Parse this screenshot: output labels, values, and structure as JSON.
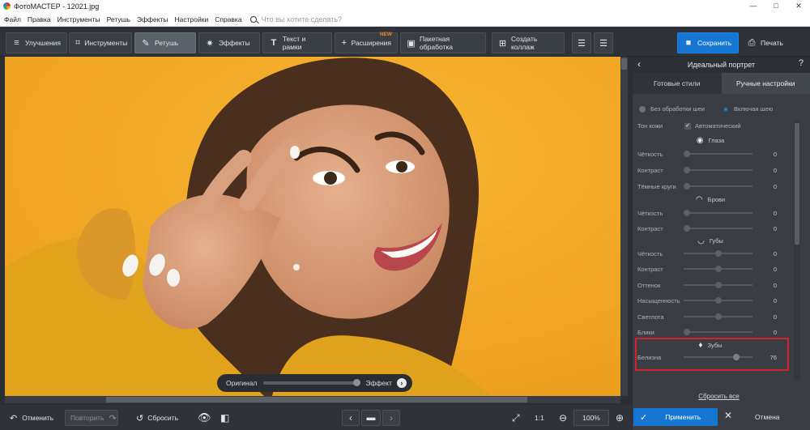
{
  "window": {
    "title": "ФотоМАСТЕР - 12021.jpg",
    "min": "—",
    "max": "□",
    "close": "✕"
  },
  "menu": {
    "items": [
      "Файл",
      "Правка",
      "Инструменты",
      "Ретушь",
      "Эффекты",
      "Настройки",
      "Справка"
    ],
    "search_placeholder": "Что вы хотите сделать?"
  },
  "toolbar": {
    "improve": "Улучшения",
    "tools": "Инструменты",
    "retouch": "Ретушь",
    "effects": "Эффекты",
    "text": "Текст и рамки",
    "ext": "Расширения",
    "ext_badge": "NEW",
    "batch": "Пакетная обработка",
    "collage": "Создать коллаж",
    "save": "Сохранить",
    "print": "Печать"
  },
  "compare": {
    "original": "Оригинал",
    "effect": "Эффект",
    "position": 0.97
  },
  "bottom": {
    "undo": "Отменить",
    "redo": "Повторить",
    "reset": "Сбросить",
    "one_to_one": "1:1",
    "zoom": "100%"
  },
  "panel": {
    "title": "Идеальный портрет",
    "tab_styles": "Готовые стили",
    "tab_manual": "Ручные настройки",
    "radio_off": "Без обработки шеи",
    "radio_on": "Включая шею",
    "skin_label": "Тон кожи",
    "skin_auto": "Автоматический",
    "eyes": {
      "title": "Глаза",
      "rows": [
        {
          "label": "Чёткость",
          "value": "0",
          "pos": 0.05
        },
        {
          "label": "Контраст",
          "value": "0",
          "pos": 0.05
        },
        {
          "label": "Тёмные круги",
          "value": "0",
          "pos": 0.05
        }
      ]
    },
    "brows": {
      "title": "Брови",
      "rows": [
        {
          "label": "Чёткость",
          "value": "0",
          "pos": 0.05
        },
        {
          "label": "Контраст",
          "value": "0",
          "pos": 0.05
        }
      ]
    },
    "lips": {
      "title": "Губы",
      "rows": [
        {
          "label": "Чёткость",
          "value": "0",
          "pos": 0.5
        },
        {
          "label": "Контраст",
          "value": "0",
          "pos": 0.5
        },
        {
          "label": "Оттенок",
          "value": "0",
          "pos": 0.5
        },
        {
          "label": "Насыщенность",
          "value": "0",
          "pos": 0.5
        },
        {
          "label": "Светлота",
          "value": "0",
          "pos": 0.5
        },
        {
          "label": "Блики",
          "value": "0",
          "pos": 0.05
        }
      ]
    },
    "teeth": {
      "title": "Зубы",
      "rows": [
        {
          "label": "Белизна",
          "value": "76",
          "pos": 0.76
        }
      ]
    },
    "reset_all": "Сбросить все",
    "apply": "Применить",
    "cancel": "Отмена"
  },
  "accent": "#1677d2",
  "highlight": "#d5212b"
}
